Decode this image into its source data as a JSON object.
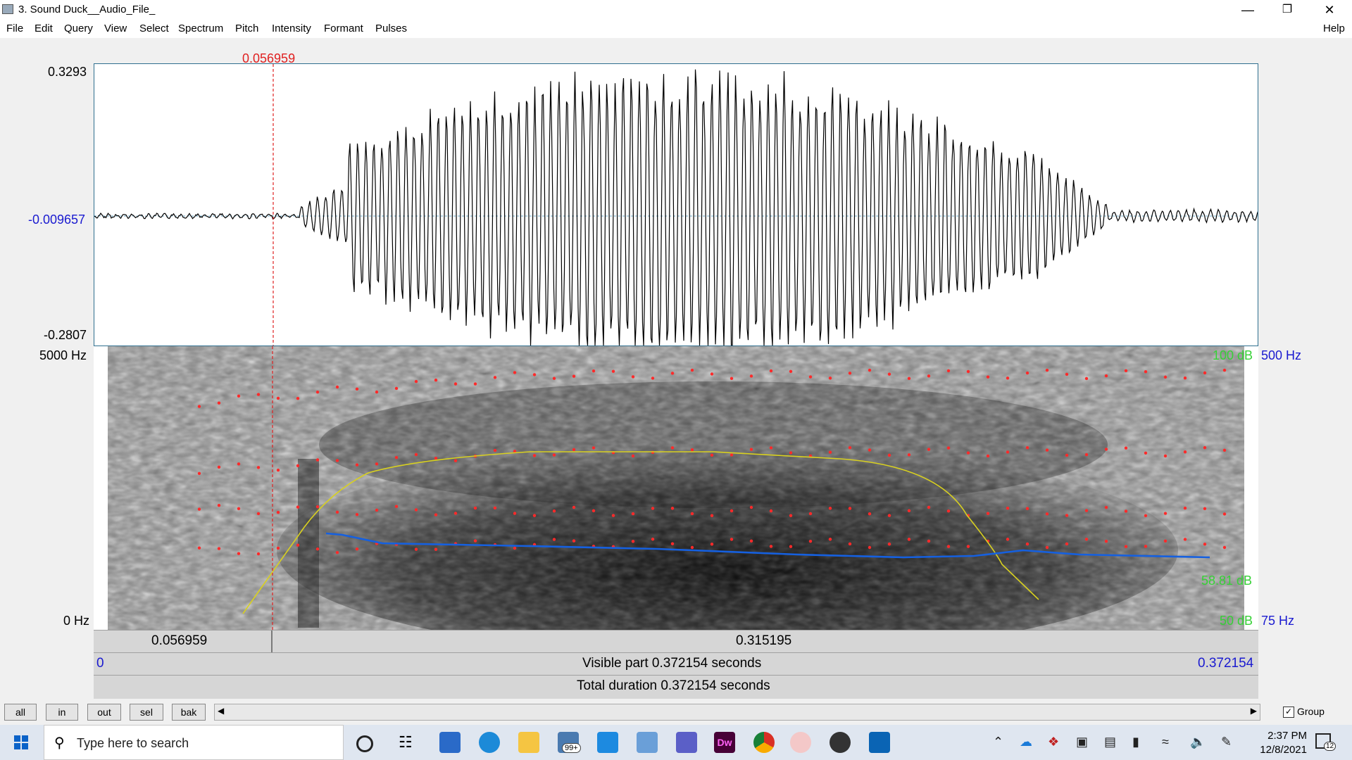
{
  "window": {
    "title": "3. Sound Duck__Audio_File_",
    "minimize": "—",
    "restore": "❐",
    "close": "✕"
  },
  "menu": [
    "File",
    "Edit",
    "Query",
    "View",
    "Select",
    "Spectrum",
    "Pitch",
    "Intensity",
    "Formant",
    "Pulses"
  ],
  "menu_help": "Help",
  "waveform": {
    "ymax": "0.3293",
    "ymid": "-0.009657",
    "ymin": "-0.2807",
    "cursor_time": "0.056959"
  },
  "spectrogram": {
    "fmax": "5000 Hz",
    "fmin": "0 Hz",
    "db_max": "100 dB",
    "db_cur": "58.81 dB",
    "db_min": "50 dB",
    "pitch_max": "500 Hz",
    "pitch_min": "75 Hz"
  },
  "time_bar": {
    "left": "0.056959",
    "right": "0.315195"
  },
  "visible_bar": {
    "start": "0",
    "label": "Visible part 0.372154 seconds",
    "end": "0.372154"
  },
  "total_bar": {
    "label": "Total duration 0.372154 seconds"
  },
  "buttons": [
    "all",
    "in",
    "out",
    "sel",
    "bak"
  ],
  "group_label": "Group",
  "taskbar": {
    "search_placeholder": "Type here to search",
    "mail_badge": "99+",
    "time": "2:37 PM",
    "date": "12/8/2021",
    "notif_count": "12"
  },
  "colors": {
    "pitch": "#1560e0",
    "intensity": "#d8d020",
    "formant": "#ff2020",
    "cursor": "#e02020"
  }
}
